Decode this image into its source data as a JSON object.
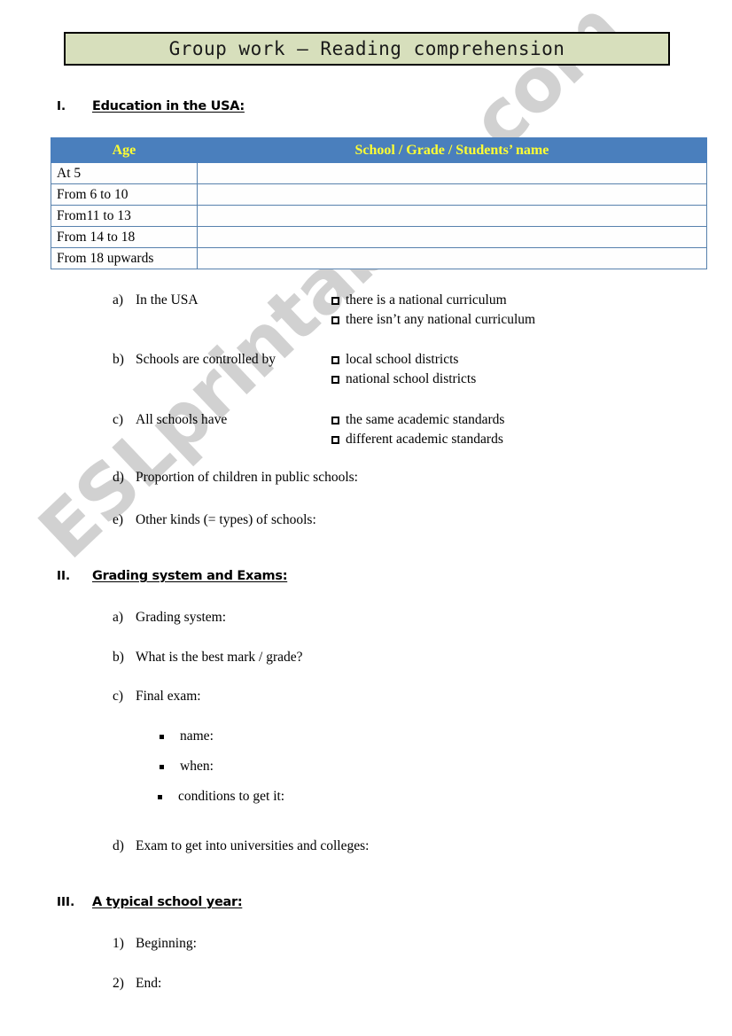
{
  "document": {
    "title_banner": "Group work – Reading comprehension",
    "colors": {
      "banner_background": "#d7dfbc",
      "banner_border": "#000000",
      "table_header_background": "#4a7fbd",
      "table_header_text": "#ffff33",
      "table_border": "#5781ad",
      "watermark": "#c9c9c9"
    },
    "watermark": "ESLprintables.com"
  },
  "sections": [
    {
      "numeral": "I.",
      "heading": "Education in the USA:"
    },
    {
      "numeral": "II.",
      "heading": "Grading system and Exams:"
    },
    {
      "numeral": "III.",
      "heading": "A typical school year:"
    }
  ],
  "table": {
    "headers": [
      "Age",
      "School / Grade / Students’ name"
    ],
    "rows": [
      {
        "age": "At 5",
        "answer": ""
      },
      {
        "age": "From 6 to 10",
        "answer": ""
      },
      {
        "age": "From11 to 13",
        "answer": ""
      },
      {
        "age": "From 14 to 18",
        "answer": ""
      },
      {
        "age": "From 18 upwards",
        "answer": ""
      }
    ]
  },
  "section1_questions": [
    {
      "marker": "a)",
      "text": "In the USA"
    },
    {
      "marker": "b)",
      "text": "Schools are controlled by"
    },
    {
      "marker": "c)",
      "text": "All schools have"
    },
    {
      "marker": "d)",
      "text": "Proportion of children in public schools:"
    },
    {
      "marker": "e)",
      "text": "Other kinds (= types) of schools:"
    }
  ],
  "section1_options": {
    "a": [
      "there is a national curriculum",
      "there isn’t any national curriculum"
    ],
    "b": [
      "local school districts",
      "national school districts"
    ],
    "c": [
      "the same academic standards",
      "different academic standards"
    ]
  },
  "section2_questions": [
    {
      "marker": "a)",
      "text": "Grading system:"
    },
    {
      "marker": "b)",
      "text": "What is the best mark / grade?"
    },
    {
      "marker": "c)",
      "text": "Final exam:"
    },
    {
      "marker": "d)",
      "text": "Exam to get into universities and colleges:"
    }
  ],
  "section2_bullets": [
    {
      "text": "name:"
    },
    {
      "text": "when:"
    },
    {
      "text": "conditions to get it:"
    }
  ],
  "section3_questions": [
    {
      "marker": "1)",
      "text": "Beginning:"
    },
    {
      "marker": "2)",
      "text": "End:"
    }
  ]
}
